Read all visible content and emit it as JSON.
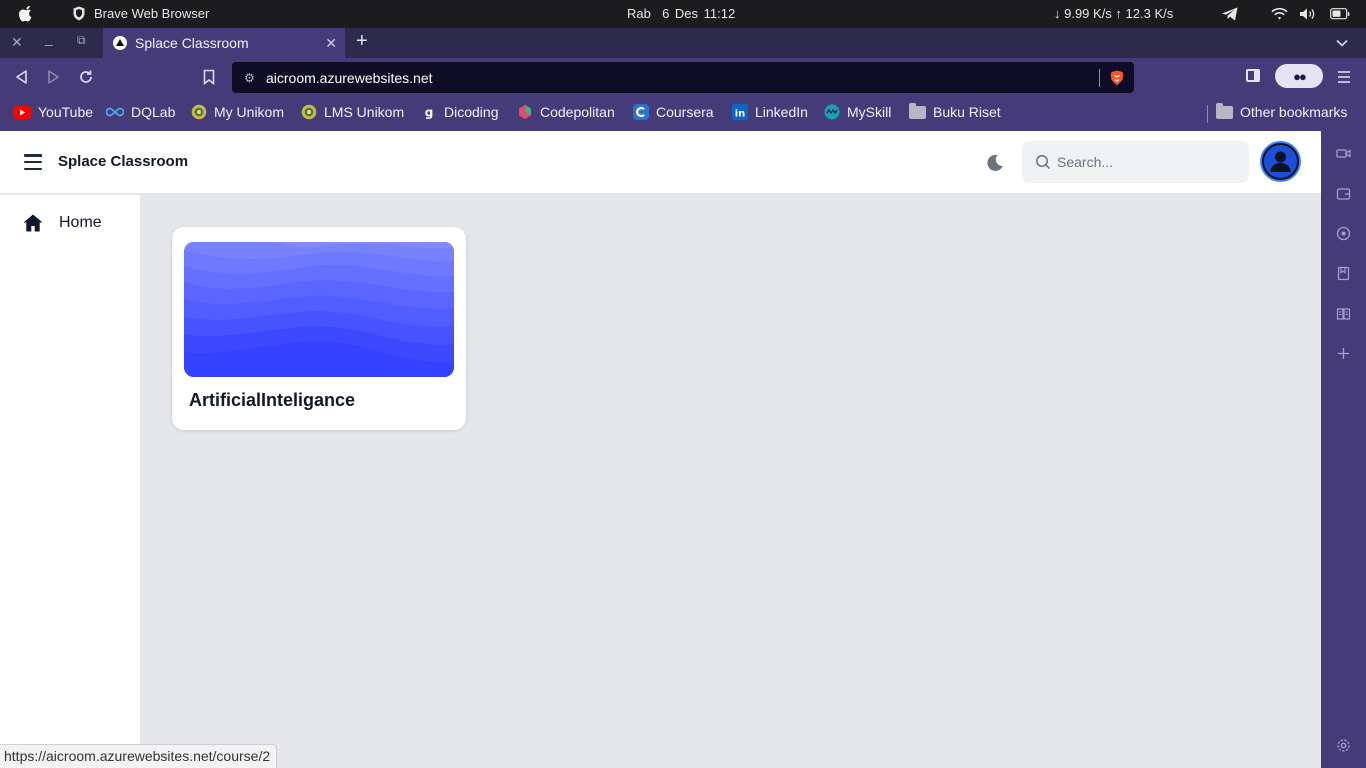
{
  "system_bar": {
    "app_name": "Brave Web Browser",
    "date": "Rab  6 Des",
    "time": "11:12",
    "network": "↓ 9.99 K/s ↑ 12.3 K/s"
  },
  "browser": {
    "tab_title": "Splace Classroom",
    "url": "aicroom.azurewebsites.net",
    "bookmarks": [
      {
        "label": "YouTube",
        "icon": "youtube-icon",
        "color": "#ff0000"
      },
      {
        "label": "DQLab",
        "icon": "dqlab-icon",
        "color": "#3a7bd5"
      },
      {
        "label": "My Unikom",
        "icon": "unikom-icon",
        "color": "#c9b33a"
      },
      {
        "label": "LMS Unikom",
        "icon": "unikom-icon",
        "color": "#c9b33a"
      },
      {
        "label": "Dicoding",
        "icon": "dicoding-icon",
        "color": "#2d3e50"
      },
      {
        "label": "Codepolitan",
        "icon": "codepolitan-icon",
        "color": "#e04e6a"
      },
      {
        "label": "Coursera",
        "icon": "coursera-icon",
        "color": "#2a73cc"
      },
      {
        "label": "LinkedIn",
        "icon": "linkedin-icon",
        "color": "#0a66c2"
      },
      {
        "label": "MySkill",
        "icon": "myskill-icon",
        "color": "#17a2b8"
      },
      {
        "label": "Buku Riset",
        "icon": "folder-icon",
        "color": "#b8b5c6"
      }
    ],
    "other_bookmarks": "Other bookmarks",
    "status_url": "https://aicroom.azurewebsites.net/course/2"
  },
  "app": {
    "brand": "Splace Classroom",
    "search_placeholder": "Search...",
    "sidebar": {
      "items": [
        {
          "label": "Home",
          "icon": "home-icon"
        }
      ]
    },
    "courses": [
      {
        "title": "ArtificialInteligance"
      }
    ]
  },
  "colors": {
    "browser_chrome": "#463b79",
    "card_banner": "#4f5bff",
    "avatar": "#3b82f6"
  }
}
